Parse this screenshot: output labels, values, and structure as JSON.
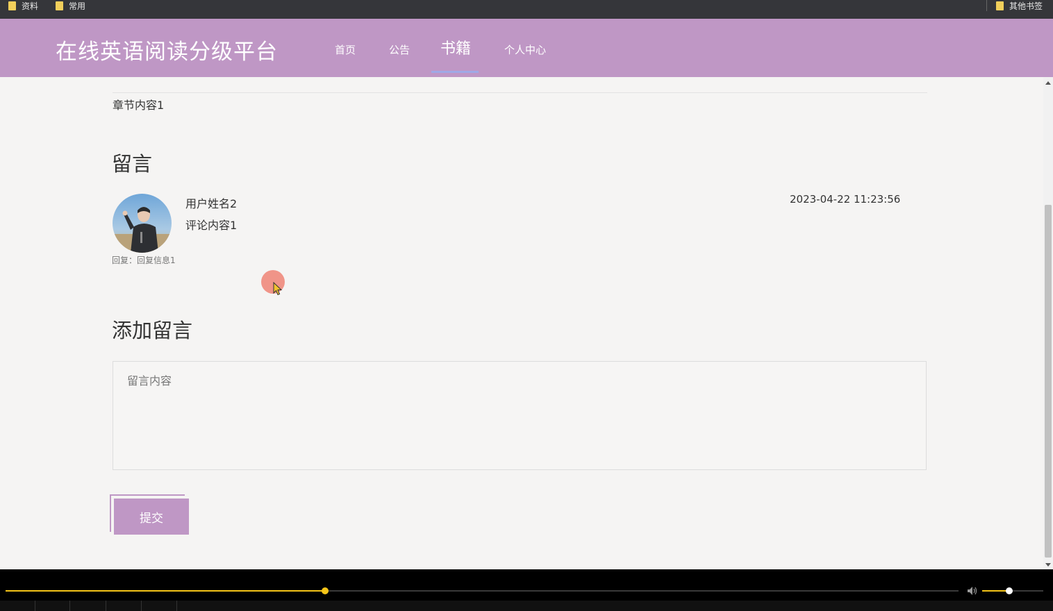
{
  "bookmarks": {
    "items": [
      {
        "label": "资料"
      },
      {
        "label": "常用"
      }
    ],
    "other_label": "其他书签"
  },
  "header": {
    "site_title": "在线英语阅读分级平台",
    "nav": [
      {
        "label": "首页"
      },
      {
        "label": "公告"
      },
      {
        "label": "书籍",
        "active": true
      },
      {
        "label": "个人中心"
      }
    ]
  },
  "chapter": {
    "content": "章节内容1"
  },
  "comments": {
    "title": "留言",
    "items": [
      {
        "user": "用户姓名2",
        "text": "评论内容1",
        "time": "2023-04-22 11:23:56",
        "reply": "回复：回复信息1"
      }
    ]
  },
  "add_comment": {
    "title": "添加留言",
    "placeholder": "留言内容",
    "submit_label": "提交"
  },
  "player": {
    "progress_fraction": 0.335,
    "volume_fraction": 0.44,
    "accent_color": "#f5c518"
  },
  "theme": {
    "primary": "#bf97c5",
    "active_underline": "#9fa9e6"
  }
}
